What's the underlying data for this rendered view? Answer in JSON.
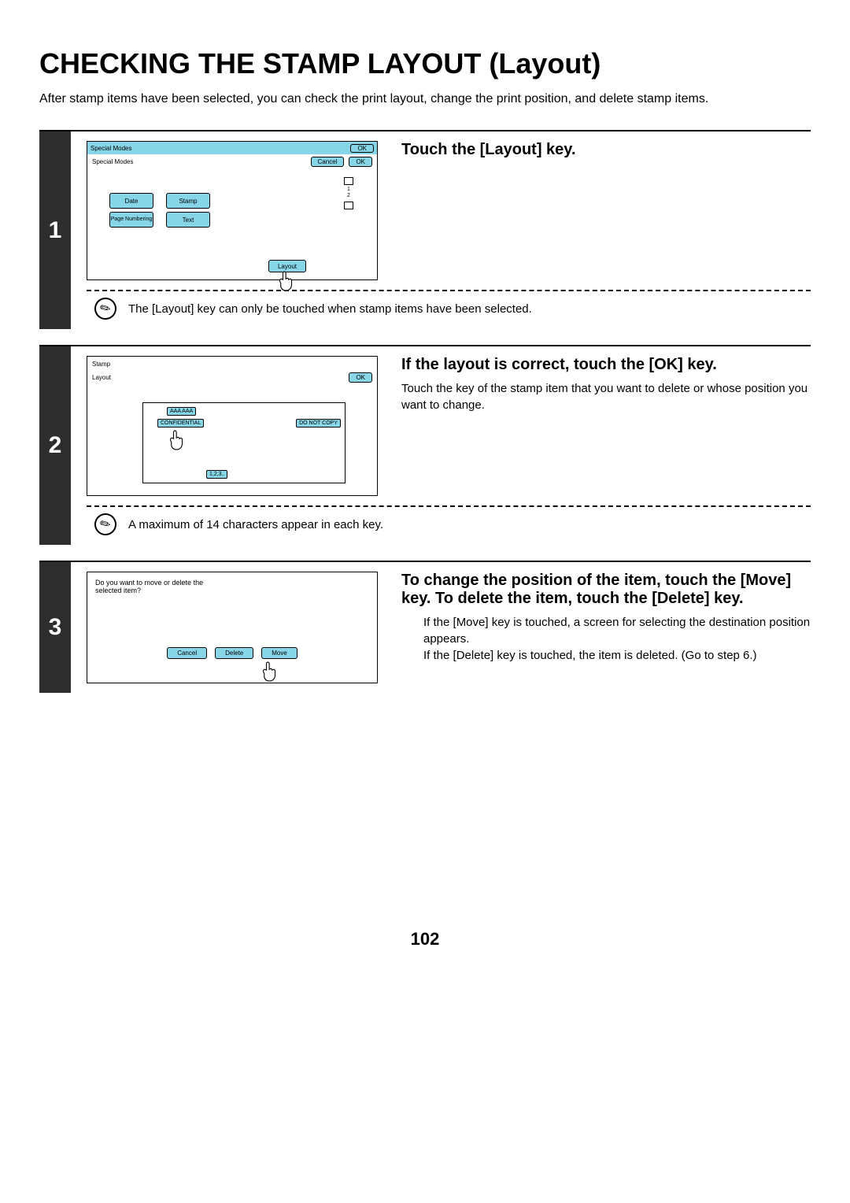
{
  "title": "CHECKING THE STAMP LAYOUT (Layout)",
  "intro": "After stamp items have been selected, you can check the print layout, change the print position, and delete stamp items.",
  "steps": {
    "s1": {
      "num": "1",
      "title": "Touch the [Layout] key.",
      "note": "The [Layout] key can only be touched when stamp items have been selected.",
      "screen": {
        "header": "Special Modes",
        "header_ok": "OK",
        "sub": "Special Modes",
        "cancel": "Cancel",
        "ok": "OK",
        "date": "Date",
        "stamp": "Stamp",
        "page_numbering": "Page Numbering",
        "text": "Text",
        "layout": "Layout",
        "pg1": "1",
        "pg2": "2"
      }
    },
    "s2": {
      "num": "2",
      "title": "If the layout is correct, touch the [OK] key.",
      "desc": "Touch the key of the stamp item that you want to delete or whose position you want to change.",
      "note": "A maximum of 14 characters appear in each key.",
      "screen": {
        "header": "Stamp",
        "sub": "Layout",
        "ok": "OK",
        "s_aaa": "AAA AAA",
        "s_conf": "CONFIDENTIAL",
        "s_dnc": "DO NOT COPY",
        "s_123": "1,2,3.."
      }
    },
    "s3": {
      "num": "3",
      "title": "To change the position of the item, touch the [Move] key. To delete the item, touch the [Delete] key.",
      "desc1": "If the [Move] key is touched, a screen for selecting the destination position appears.",
      "desc2": "If the [Delete] key is touched, the item is deleted. (Go to step 6.)",
      "screen": {
        "prompt": "Do you want to move or delete the selected item?",
        "cancel": "Cancel",
        "delete": "Delete",
        "move": "Move"
      }
    }
  },
  "page_number": "102"
}
